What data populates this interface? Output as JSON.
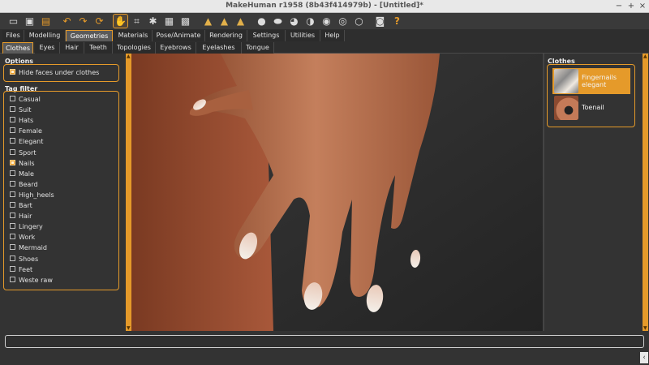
{
  "window": {
    "title": "MakeHuman r1958 (8b43f414979b) - [Untitled]*",
    "minimize": "−",
    "maximize": "+",
    "close": "×"
  },
  "toolbar": {
    "icons": [
      "toggle-smooth-icon",
      "save-icon",
      "load-icon",
      "undo-icon",
      "redo-icon",
      "reset-icon",
      "pose-icon",
      "wireframe-icon",
      "skeleton-icon",
      "grid-icon",
      "checker-icon",
      "front-view-icon",
      "side-view-icon",
      "back-view-icon",
      "head-icon",
      "head-side-icon",
      "body-icon",
      "body-side-icon",
      "top-view-icon",
      "reset-camera-icon",
      "screenshot-icon",
      "help-icon"
    ]
  },
  "main_tabs": [
    "Files",
    "Modelling",
    "Geometries",
    "Materials",
    "Pose/Animate",
    "Rendering",
    "Settings",
    "Utilities",
    "Help"
  ],
  "selected_main_tab": "Geometries",
  "sub_tabs": [
    "Clothes",
    "Eyes",
    "Hair",
    "Teeth",
    "Topologies",
    "Eyebrows",
    "Eyelashes",
    "Tongue"
  ],
  "selected_sub_tab": "Clothes",
  "options": {
    "title": "Options",
    "hide_faces_label": "Hide faces under clothes",
    "hide_faces_checked": true
  },
  "tag_filter": {
    "title": "Tag filter",
    "tags": [
      {
        "label": "Casual",
        "checked": false
      },
      {
        "label": "Suit",
        "checked": false
      },
      {
        "label": "Hats",
        "checked": false
      },
      {
        "label": "Female",
        "checked": false
      },
      {
        "label": "Elegant",
        "checked": false
      },
      {
        "label": "Sport",
        "checked": false
      },
      {
        "label": "Nails",
        "checked": true
      },
      {
        "label": "Male",
        "checked": false
      },
      {
        "label": "Beard",
        "checked": false
      },
      {
        "label": "High_heels",
        "checked": false
      },
      {
        "label": "Bart",
        "checked": false
      },
      {
        "label": "Hair",
        "checked": false
      },
      {
        "label": "Lingery",
        "checked": false
      },
      {
        "label": "Work",
        "checked": false
      },
      {
        "label": "Mermaid",
        "checked": false
      },
      {
        "label": "Shoes",
        "checked": false
      },
      {
        "label": "Feet",
        "checked": false
      },
      {
        "label": "Weste raw",
        "checked": false
      }
    ]
  },
  "clothes": {
    "title": "Clothes",
    "items": [
      {
        "line1": "Fingernails",
        "line2": "elegant",
        "selected": true
      },
      {
        "line1": "Toenail",
        "line2": "",
        "selected": false
      }
    ]
  },
  "colors": {
    "accent": "#e59a2a",
    "background": "#333333",
    "skin": "#b06a45"
  }
}
